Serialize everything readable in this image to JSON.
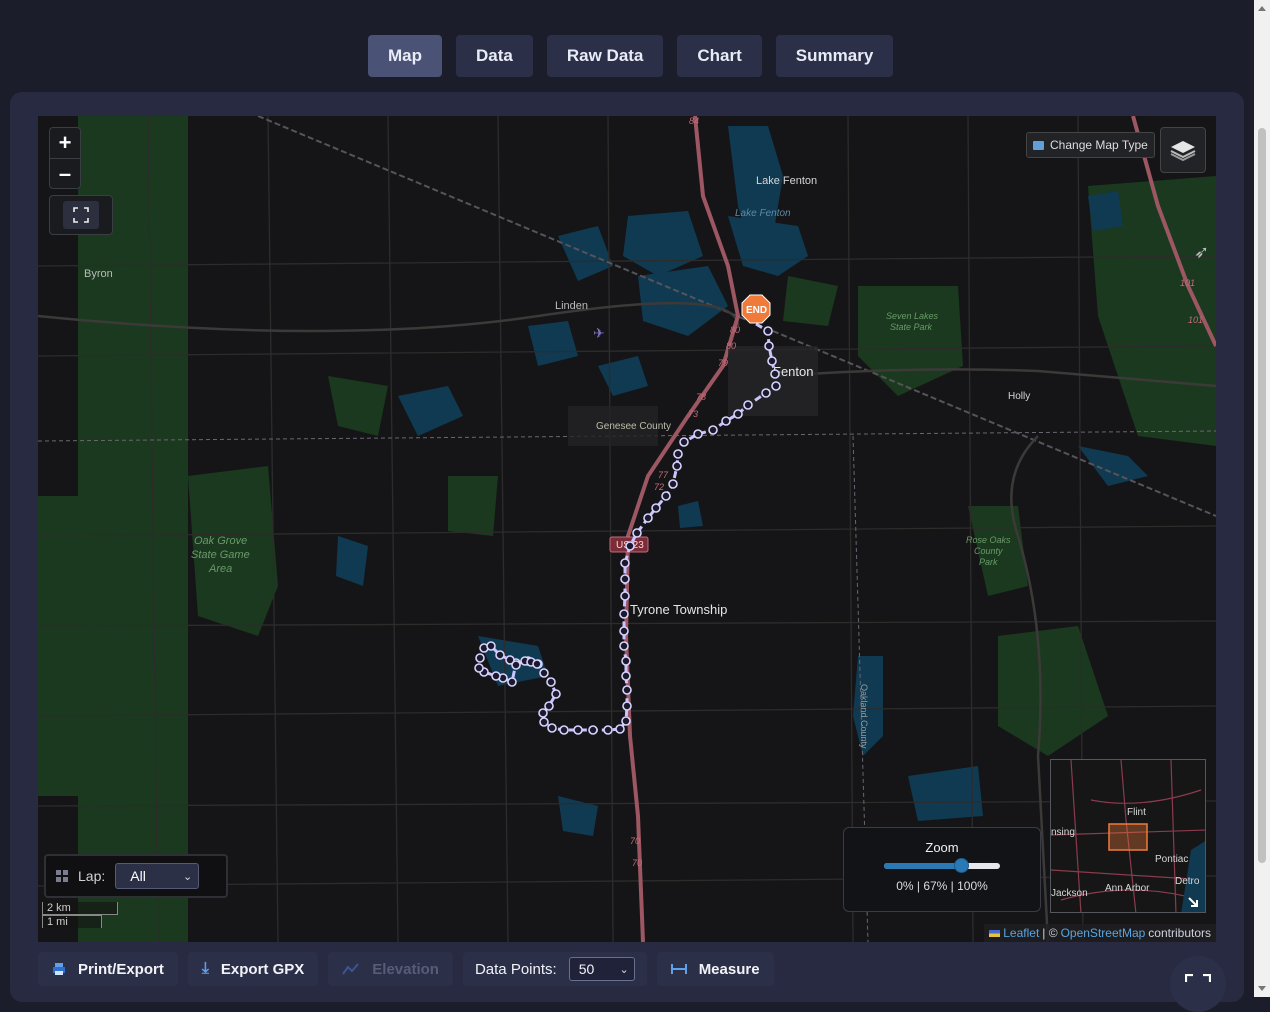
{
  "tabs": [
    {
      "label": "Map",
      "active": true
    },
    {
      "label": "Data",
      "active": false
    },
    {
      "label": "Raw Data",
      "active": false
    },
    {
      "label": "Chart",
      "active": false
    },
    {
      "label": "Summary",
      "active": false
    }
  ],
  "map": {
    "zoom_in": "+",
    "zoom_out": "–",
    "change_map_type": "Change Map Type",
    "place_labels": {
      "lake_fenton": "Lake Fenton",
      "lake_fenton_water": "Lake Fenton",
      "byron": "Byron",
      "linden": "Linden",
      "fenton": "Fenton",
      "holly": "Holly",
      "genesee_county": "Genesee County",
      "seven_lakes_1": "Seven Lakes",
      "seven_lakes_2": "State Park",
      "tyrone": "Tyrone Township",
      "oak_grove_1": "Oak Grove",
      "oak_grove_2": "State Game",
      "oak_grove_3": "Area",
      "rose_oaks_1": "Rose Oaks",
      "rose_oaks_2": "County",
      "rose_oaks_3": "Park",
      "oakland_county": "Oakland County",
      "us23": "US 23"
    },
    "road_numbers": {
      "r84": "84",
      "r80a": "80",
      "r80b": "80",
      "r79": "79",
      "r78": "78",
      "r73": "73",
      "r77": "77",
      "r72": "72",
      "r70a": "70",
      "r70b": "70",
      "r101a": "101",
      "r101b": "101"
    },
    "end_marker": "END",
    "lap": {
      "label": "Lap:",
      "value": "All"
    },
    "scale": {
      "metric": "2 km",
      "imperial": "1 mi"
    },
    "zoom_panel": {
      "title": "Zoom",
      "value_percent": 67,
      "marks": "0%  |  67%  |  100%"
    },
    "minimap_labels": {
      "flint": "Flint",
      "lansing": "nsing",
      "pontiac": "Pontiac",
      "jackson": "Jackson",
      "ann_arbor": "Ann Arbor",
      "detroit": "Detro"
    },
    "attribution": {
      "leaflet": "Leaflet",
      "sep": "| ©",
      "osm": "OpenStreetMap",
      "contributors": "contributors"
    }
  },
  "toolbar": {
    "print": "Print/Export",
    "export_gpx": "Export GPX",
    "elevation": "Elevation",
    "data_points_label": "Data Points:",
    "data_points_value": "50",
    "measure": "Measure"
  },
  "colors": {
    "route": "#b9b4ff",
    "end_marker": "#f07a3a",
    "highway": "#9c5763",
    "water": "#0f3a52",
    "park": "#1d4a22"
  }
}
